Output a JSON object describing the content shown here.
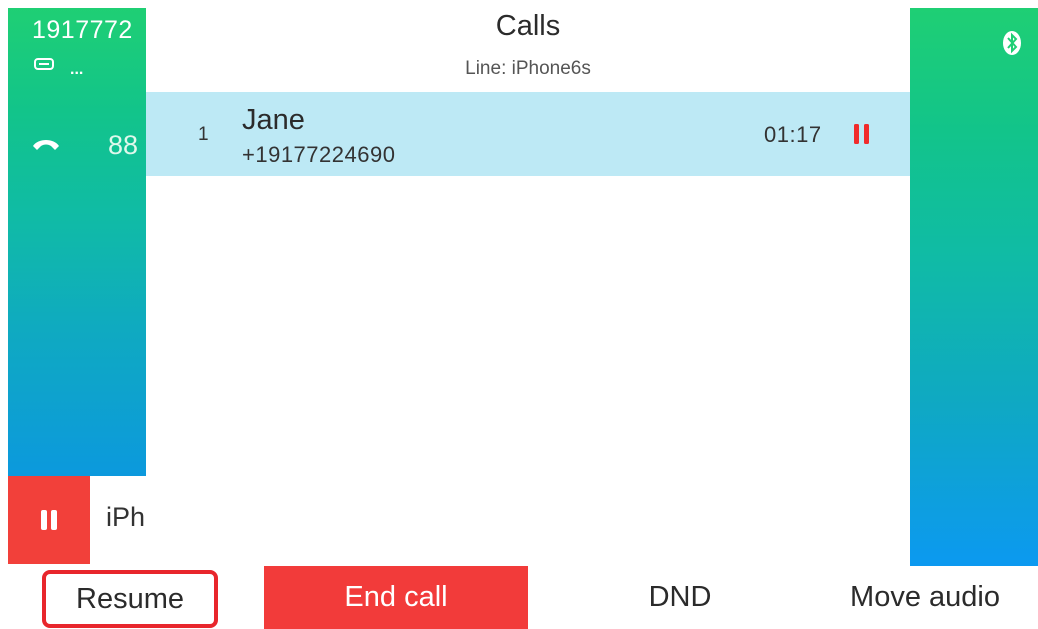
{
  "left_panel": {
    "line_number": "1917772",
    "status_dots": "...",
    "extension": "88",
    "held_line_label": "iPh"
  },
  "header": {
    "title": "Calls",
    "subtitle": "Line: iPhone6s"
  },
  "calls": [
    {
      "index": "1",
      "name": "Jane",
      "number": "+19177224690",
      "duration": "01:17",
      "state": "held"
    }
  ],
  "softkeys": {
    "resume": "Resume",
    "end_call": "End call",
    "dnd": "DND",
    "move_audio": "Move audio"
  },
  "icons": {
    "status": "message-icon",
    "phone": "handset-icon",
    "hold": "pause-icon",
    "bluetooth": "bluetooth-icon"
  },
  "colors": {
    "accent_green": "#1fcf74",
    "accent_blue": "#0c99f0",
    "hold_red": "#f23b3a",
    "selected_row": "#bde9f5",
    "highlight_outline": "#e8262c"
  }
}
